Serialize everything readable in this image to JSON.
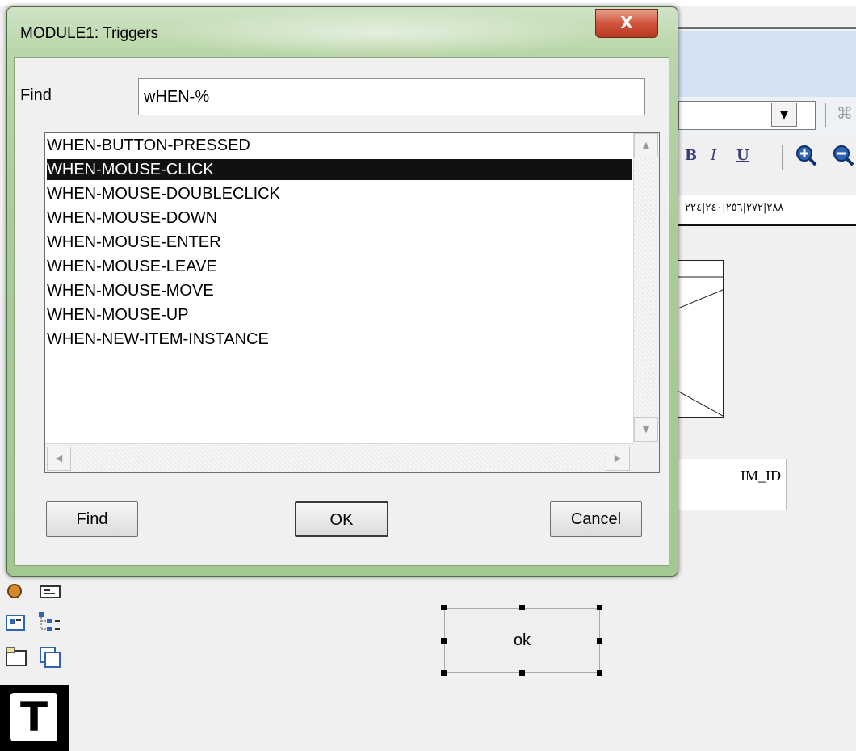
{
  "dialog": {
    "title": "MODULE1: Triggers",
    "close_glyph": "X",
    "find_label": "Find",
    "find_value": "wHEN-%",
    "triggers": [
      "WHEN-BUTTON-PRESSED",
      "WHEN-MOUSE-CLICK",
      "WHEN-MOUSE-DOUBLECLICK",
      "WHEN-MOUSE-DOWN",
      "WHEN-MOUSE-ENTER",
      "WHEN-MOUSE-LEAVE",
      "WHEN-MOUSE-MOVE",
      "WHEN-MOUSE-UP",
      "WHEN-NEW-ITEM-INSTANCE"
    ],
    "selected_trigger": "WHEN-MOUSE-CLICK",
    "buttons": {
      "find": "Find",
      "ok": "OK",
      "cancel": "Cancel"
    }
  },
  "background": {
    "format_toolbar": {
      "bold": "B",
      "italic": "I",
      "underline": "U"
    },
    "ruler_text": "٢٨٨|٢٧٢|٢٥٦|٢٤٠|٢٢٤",
    "text_item_label": "IM_ID",
    "canvas_button_label": "ok",
    "tool_palette_text_tool": "T",
    "combo_arrow": "▼"
  },
  "colors": {
    "dialog_frame": "#a9cc98",
    "selection_bg": "#111111",
    "close_button": "#c8452c",
    "toolbar_blue": "#d3e2f2"
  }
}
